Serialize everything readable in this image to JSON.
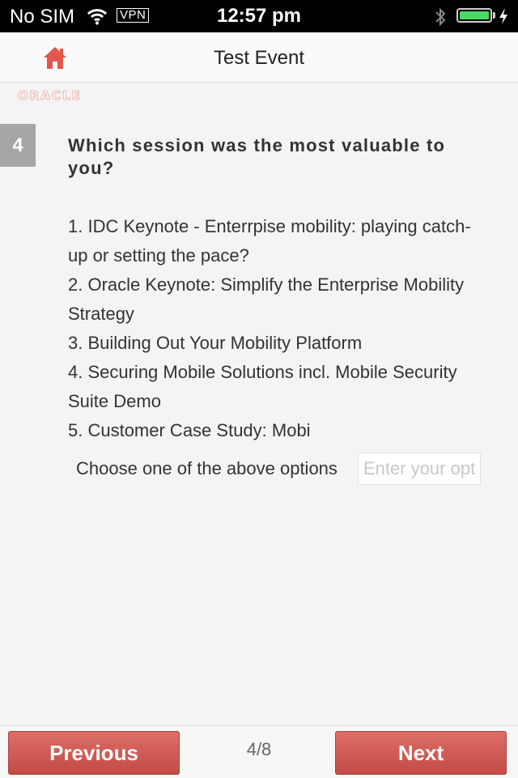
{
  "status_bar": {
    "carrier": "No SIM",
    "vpn": "VPN",
    "time": "12:57 pm"
  },
  "nav": {
    "title": "Test Event",
    "logo_text": "ORACLE"
  },
  "question": {
    "number": "4",
    "text": "Which session was the most valuable to you?",
    "options": [
      "1. IDC Keynote - Enterrpise mobility: playing catch-up or setting the pace?",
      "2. Oracle Keynote: Simplify the Enterprise Mobility Strategy",
      "3. Building Out Your Mobility Platform",
      "4. Securing Mobile Solutions incl. Mobile Security Suite Demo",
      "5. Customer Case Study: Mobi"
    ],
    "choose_label": "Choose one of the above options",
    "input_placeholder": "Enter your option",
    "input_value": ""
  },
  "footer": {
    "previous_label": "Previous",
    "next_label": "Next",
    "pager": "4/8"
  },
  "colors": {
    "accent": "#cc5b54",
    "battery": "#4cd964",
    "home_icon": "#e4574c"
  },
  "icons": [
    "wifi-icon",
    "bluetooth-icon",
    "battery-icon",
    "charging-icon",
    "home-icon"
  ]
}
